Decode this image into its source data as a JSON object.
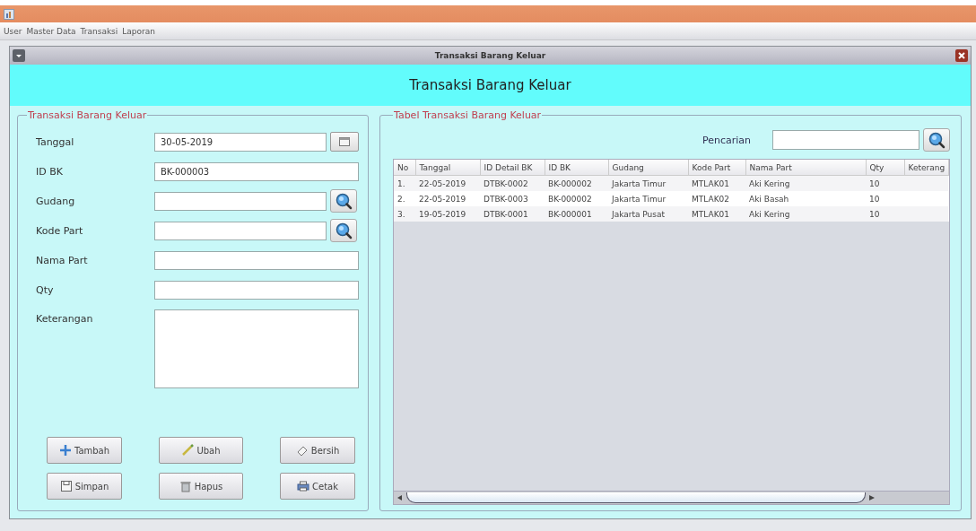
{
  "menu": [
    {
      "label": "User"
    },
    {
      "label": "Master Data"
    },
    {
      "label": "Transaksi"
    },
    {
      "label": "Laporan"
    }
  ],
  "window": {
    "title": "Transaksi Barang Keluar"
  },
  "header": {
    "title": "Transaksi Barang Keluar"
  },
  "form": {
    "title": "Transaksi Barang Keluar",
    "fields": [
      {
        "label": "Tanggal",
        "value": "30-05-2019",
        "kind": "date"
      },
      {
        "label": "ID BK",
        "value": "BK-000003",
        "kind": "text"
      },
      {
        "label": "Gudang",
        "kind": "lookup"
      },
      {
        "label": "Kode Part",
        "kind": "lookup"
      },
      {
        "label": "Nama Part",
        "kind": "text"
      },
      {
        "label": "Qty",
        "kind": "text"
      },
      {
        "label": "Keterangan",
        "kind": "textarea"
      }
    ],
    "buttons": [
      {
        "label": "Tambah",
        "kind": "add"
      },
      {
        "label": "Ubah",
        "kind": "edit"
      },
      {
        "label": "Bersih",
        "kind": "clear"
      },
      {
        "label": "Simpan",
        "kind": "save"
      },
      {
        "label": "Hapus",
        "kind": "delete"
      },
      {
        "label": "Cetak",
        "kind": "print"
      }
    ]
  },
  "table_panel": {
    "title": "Tabel Transaksi Barang Keluar",
    "search": {
      "label": "Pencarian"
    },
    "table": {
      "columns": [
        "No",
        "Tanggal",
        "ID Detail BK",
        "ID BK",
        "Gudang",
        "Kode Part",
        "Nama Part",
        "Qty",
        "Keterang"
      ],
      "rows": [
        [
          "1.",
          "22-05-2019",
          "DTBK-0002",
          "BK-000002",
          "Jakarta Timur",
          "MTLAK01",
          "Aki Kering",
          "10"
        ],
        [
          "2.",
          "22-05-2019",
          "DTBK-0003",
          "BK-000002",
          "Jakarta Timur",
          "MTLAK02",
          "Aki Basah",
          "10"
        ],
        [
          "3.",
          "19-05-2019",
          "DTBK-0001",
          "BK-000001",
          "Jakarta Pusat",
          "MTLAK01",
          "Aki Kering",
          "10"
        ]
      ]
    }
  }
}
